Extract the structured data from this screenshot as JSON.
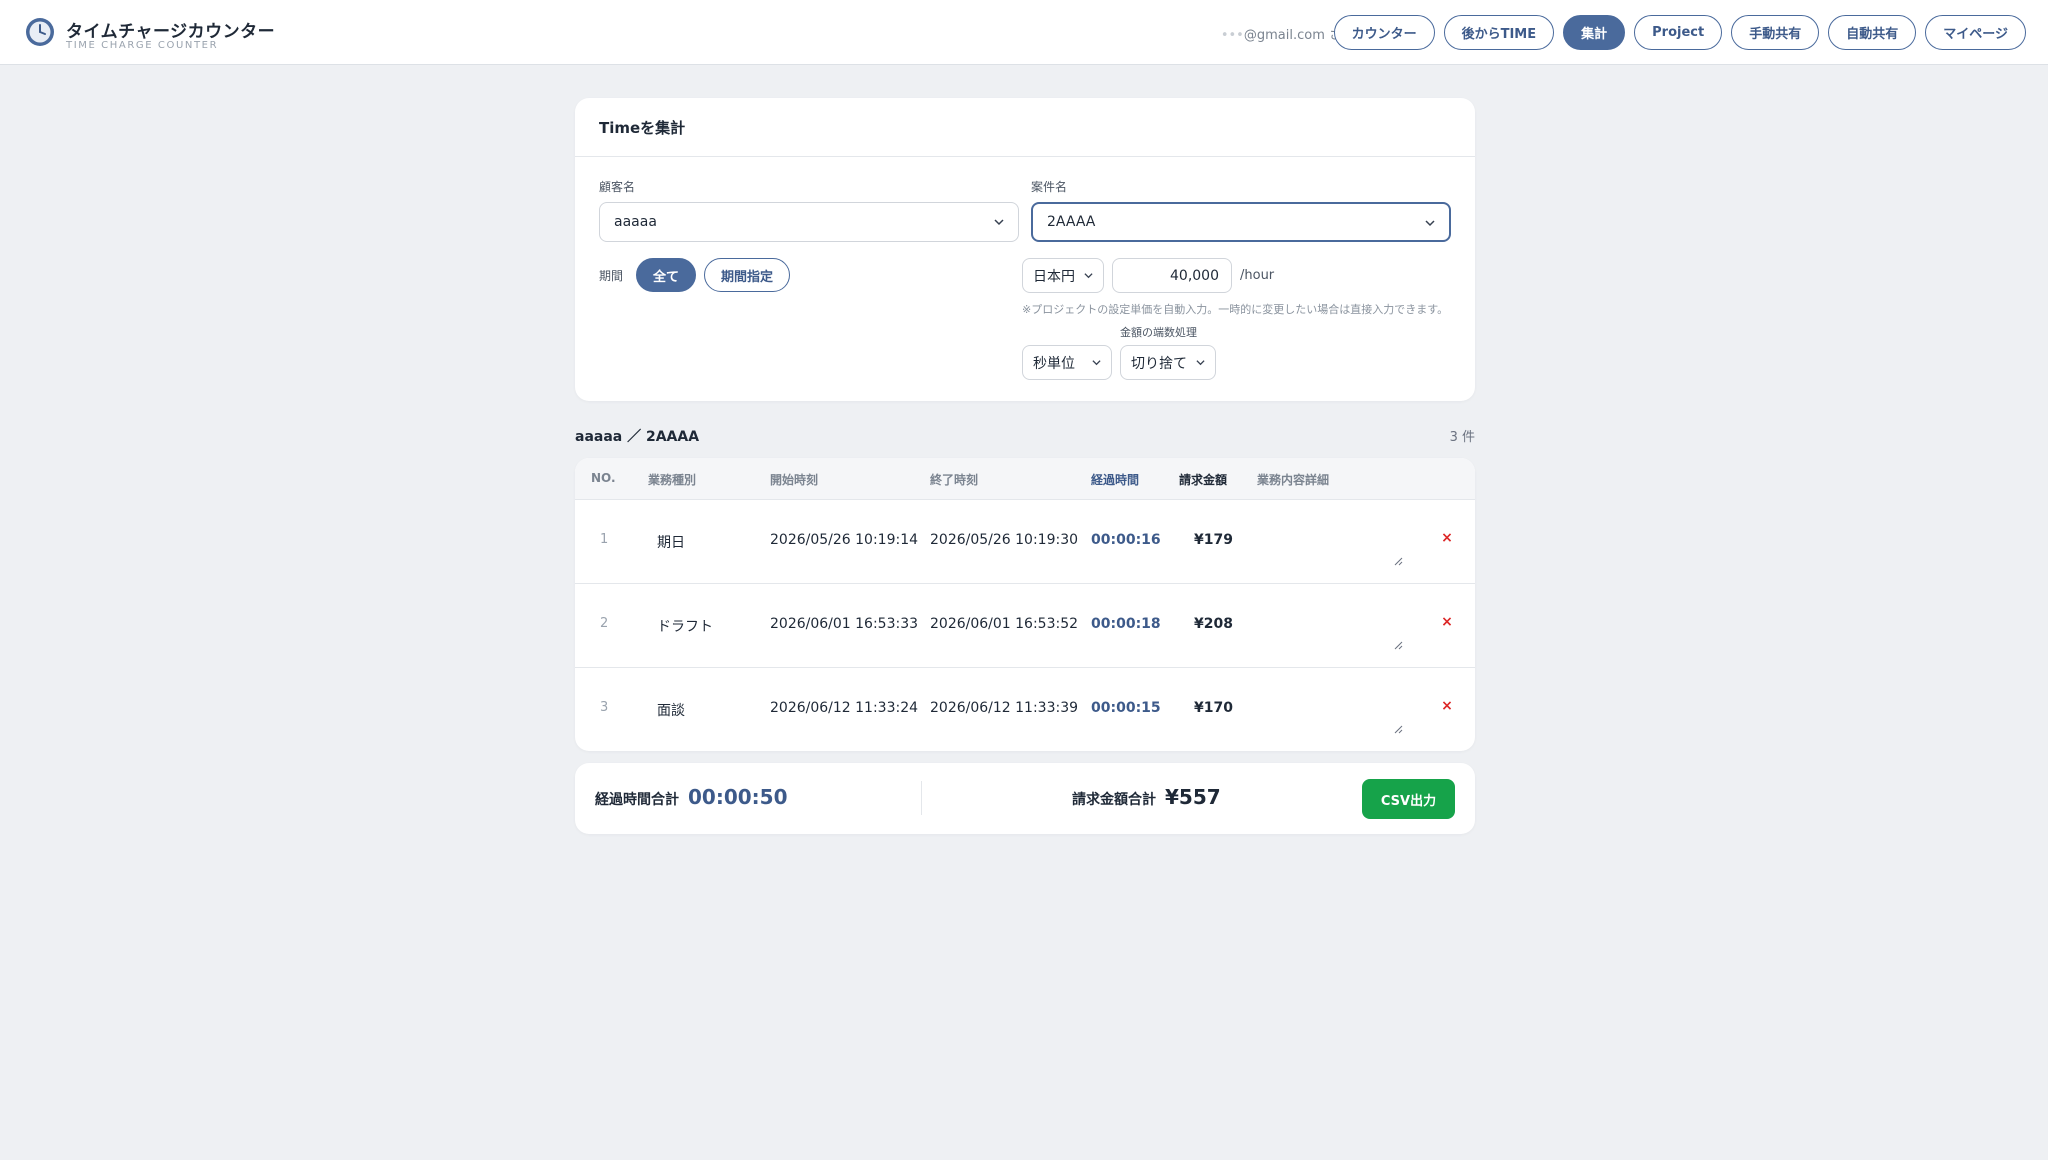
{
  "header": {
    "title": "タイムチャージカウンター",
    "subtitle": "TIME CHARGE COUNTER",
    "user_mask": "•••",
    "user_email": "@gmail.com さん",
    "nav": [
      {
        "label": "カウンター",
        "active": false
      },
      {
        "label": "後からTIME",
        "active": false
      },
      {
        "label": "集計",
        "active": true
      },
      {
        "label": "Project",
        "active": false
      },
      {
        "label": "手動共有",
        "active": false
      },
      {
        "label": "自動共有",
        "active": false
      },
      {
        "label": "マイページ",
        "active": false
      }
    ]
  },
  "filter": {
    "title": "Timeを集計",
    "customer_label": "顧客名",
    "customer_value": "aaaaa",
    "project_label": "案件名",
    "project_value": "2AAAA",
    "period_label": "期間",
    "period_all": "全て",
    "period_custom": "期間指定",
    "currency": "日本円",
    "rate": "40,000",
    "rate_unit": "/hour",
    "rate_note": "※プロジェクトの設定単価を自動入力。一時的に変更したい場合は直接入力できます。",
    "rounding_label": "金額の端数処理",
    "time_unit": "秒単位",
    "rounding": "切り捨て"
  },
  "section": {
    "title": "aaaaa ／ 2AAAA",
    "count": "3 件"
  },
  "table": {
    "headers": {
      "no": "NO.",
      "task": "業務種別",
      "start": "開始時刻",
      "end": "終了時刻",
      "elapsed": "経過時間",
      "amount": "請求金額",
      "detail": "業務内容詳細"
    },
    "rows": [
      {
        "no": "1",
        "task": "期日",
        "start": "2026/05/26 10:19:14",
        "end": "2026/05/26 10:19:30",
        "elapsed": "00:00:16",
        "amount": "¥179"
      },
      {
        "no": "2",
        "task": "ドラフト",
        "start": "2026/06/01 16:53:33",
        "end": "2026/06/01 16:53:52",
        "elapsed": "00:00:18",
        "amount": "¥208"
      },
      {
        "no": "3",
        "task": "面談",
        "start": "2026/06/12 11:33:24",
        "end": "2026/06/12 11:33:39",
        "elapsed": "00:00:15",
        "amount": "¥170"
      }
    ],
    "delete_glyph": "×"
  },
  "totals": {
    "elapsed_label": "経過時間合計",
    "elapsed_value": "00:00:50",
    "amount_label": "請求金額合計",
    "amount_value": "¥557",
    "csv_label": "CSV出力"
  },
  "colors": {
    "accent": "#4a6a9c",
    "csv_button": "#16a34a",
    "delete": "#dc2626",
    "background": "#eef0f3"
  }
}
